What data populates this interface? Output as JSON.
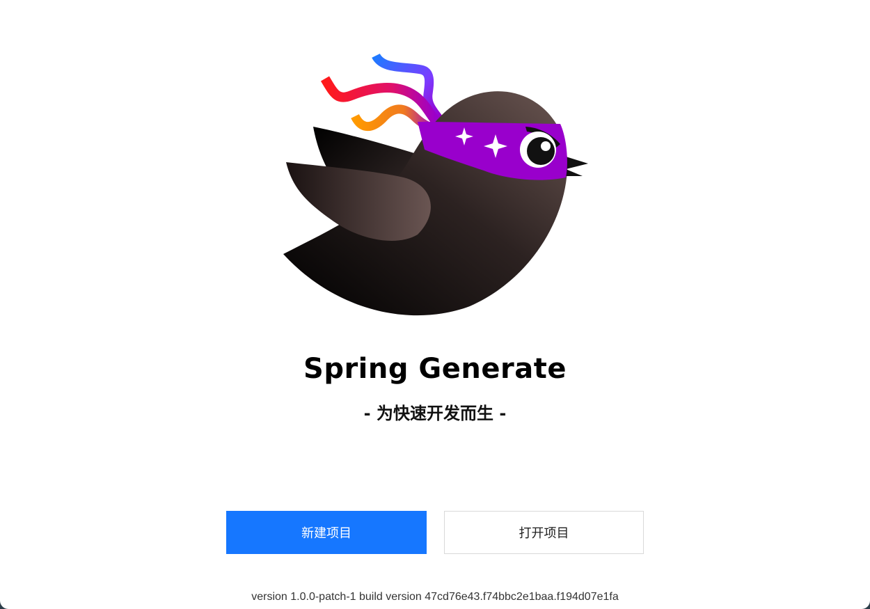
{
  "app": {
    "title": "Spring Generate",
    "subtitle": "- 为快速开发而生 -",
    "logo_icon": "ninja-bird-logo"
  },
  "actions": {
    "new_project_label": "新建项目",
    "open_project_label": "打开项目"
  },
  "footer": {
    "version_text": "version 1.0.0-patch-1 build version 47cd76e43.f74bbc2e1baa.f194d07e1fa"
  },
  "colors": {
    "primary": "#1677ff",
    "headband": "#9900cc",
    "bird_body": "#4a3a38"
  }
}
